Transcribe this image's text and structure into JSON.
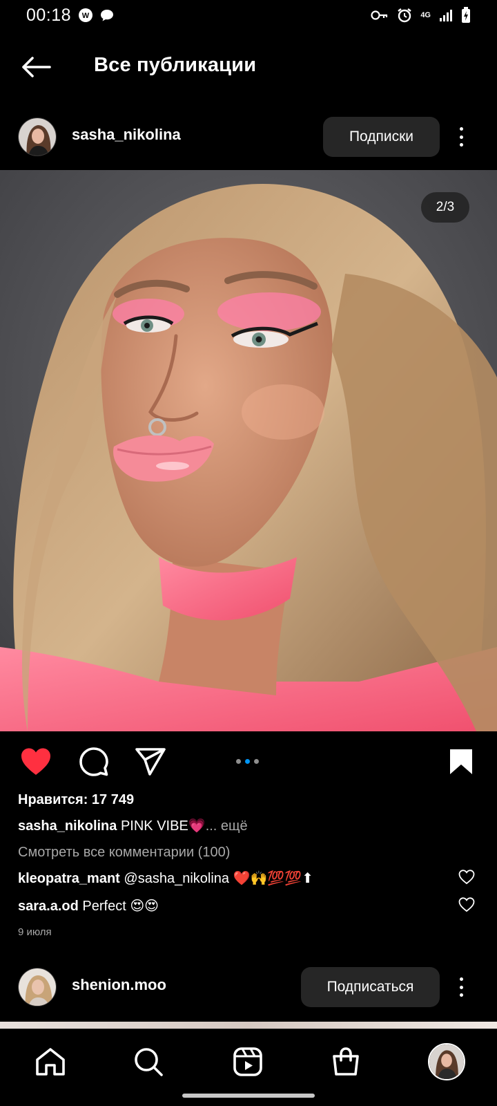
{
  "status_bar": {
    "time": "00:18",
    "network": "4G"
  },
  "header": {
    "title": "Все публикации"
  },
  "post": {
    "username": "sasha_nikolina",
    "follow_label": "Подписки",
    "image_counter": "2/3",
    "carousel": {
      "count": 3,
      "active_index": 1
    },
    "liked": true,
    "saved": true,
    "likes": "Нравится: 17 749",
    "caption_user": "sasha_nikolina",
    "caption_text": "PINK VIBE",
    "caption_emoji": "💗",
    "caption_more": "... ещё",
    "view_comments": "Смотреть все комментарии (100)",
    "comments": [
      {
        "user": "kleopatra_mant",
        "text": "@sasha_nikolina",
        "emoji": "❤️🙌💯💯⬆"
      },
      {
        "user": "sara.a.od",
        "text": "Perfect",
        "emoji": "😍😍"
      }
    ],
    "date": "9 июля"
  },
  "next_post": {
    "username": "shenion.moo",
    "follow_label": "Подписаться"
  },
  "colors": {
    "background": "#000000",
    "like_red": "#ff3040",
    "accent_blue": "#0095f6",
    "button_bg": "#262626",
    "secondary_text": "#a8a8a8"
  },
  "icons": {
    "back": "arrow-left-icon",
    "more": "more-vertical-icon",
    "like": "heart-filled-icon",
    "comment": "comment-icon",
    "share": "share-icon",
    "save": "bookmark-filled-icon",
    "nav": [
      "home-icon",
      "search-icon",
      "reels-icon",
      "shop-icon",
      "profile-avatar"
    ]
  }
}
